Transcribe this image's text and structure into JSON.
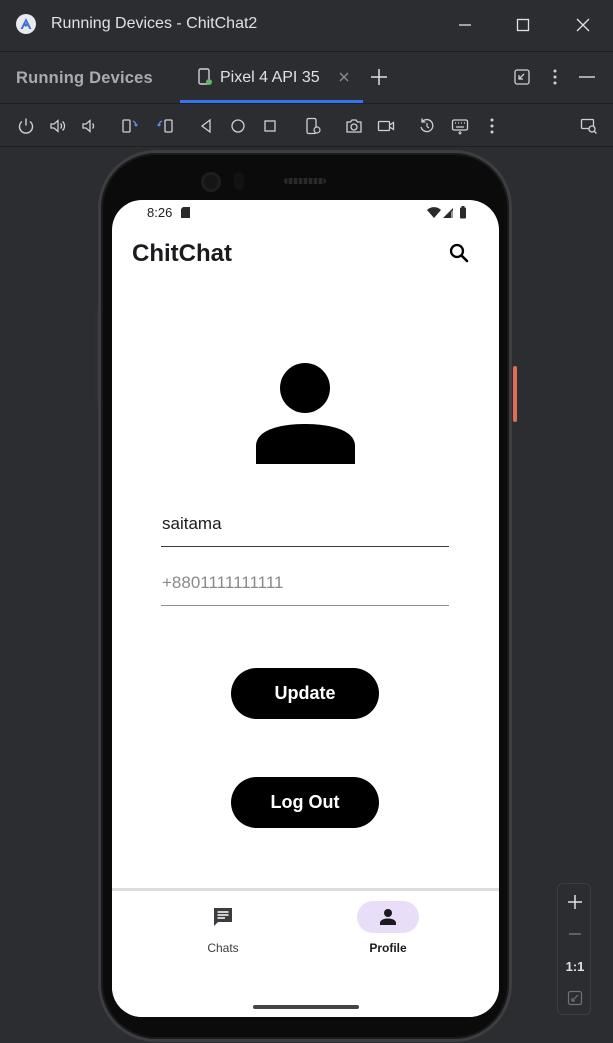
{
  "window": {
    "title": "Running Devices - ChitChat2",
    "tool_window_title": "Running Devices",
    "tab_label": "Pixel 4 API 35"
  },
  "toolbar": {
    "icons": [
      "power-icon",
      "volume-up-icon",
      "volume-down-icon",
      "rotate-left-icon",
      "rotate-right-icon",
      "back-icon",
      "home-icon",
      "overview-icon",
      "device-settings-icon",
      "screenshot-icon",
      "screen-record-icon",
      "reset-icon",
      "keyboard-icon",
      "more-icon",
      "zoom-inspect-icon"
    ]
  },
  "status_bar": {
    "time": "8:26"
  },
  "app": {
    "title": "ChitChat",
    "name_value": "saitama",
    "phone_placeholder": "+8801111111111",
    "update_label": "Update",
    "logout_label": "Log Out"
  },
  "nav": {
    "items": [
      {
        "label": "Chats",
        "selected": false
      },
      {
        "label": "Profile",
        "selected": true
      }
    ]
  },
  "zoom": {
    "ratio_label": "1:1"
  },
  "colors": {
    "ide_background": "#2b2d30",
    "tab_underline": "#3574f0",
    "nav_indicator": "#e8def8",
    "side_button": "#e06c5a"
  }
}
